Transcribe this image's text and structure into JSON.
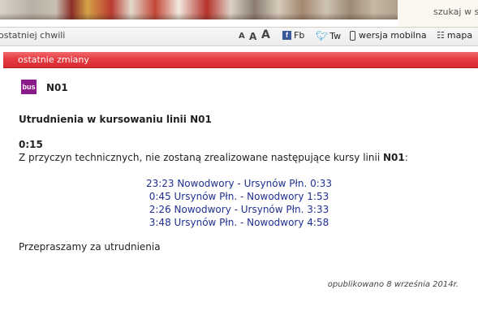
{
  "header": {
    "search_label": "szukaj w s"
  },
  "toolbar": {
    "left_text": "ostatniej chwili",
    "font_sizes": [
      "A",
      "A",
      "A"
    ],
    "facebook_label": "Fb",
    "twitter_label": "Tw",
    "mobile_label": "wersja mobilna",
    "map_label": "mapa"
  },
  "section": {
    "title": "ostatnie zmiany"
  },
  "article": {
    "line_icon": "bus",
    "line_number": "N01",
    "headline": "Utrudnienia w kursowaniu linii N01",
    "time": "0:15",
    "notice_text": "Z przyczyn technicznych, nie zostaną zrealizowane następujące kursy linii ",
    "notice_line": "N01",
    "notice_end": ":",
    "courses": [
      "23:23 Nowodwory - Ursynów Płn. 0:33",
      "0:45 Ursynów Płn. - Nowodwory 1:53",
      "2:26 Nowodwory - Ursynów Płn. 3:33",
      "3:48 Ursynów Płn. - Nowodwory 4:58"
    ],
    "apology": "Przepraszamy za utrudnienia",
    "published": "opublikowano 8 września 2014r."
  },
  "colors": {
    "accent_red": "#e63c42",
    "bus_icon": "#8a1a8a",
    "link_blue": "#1f2f8f"
  }
}
